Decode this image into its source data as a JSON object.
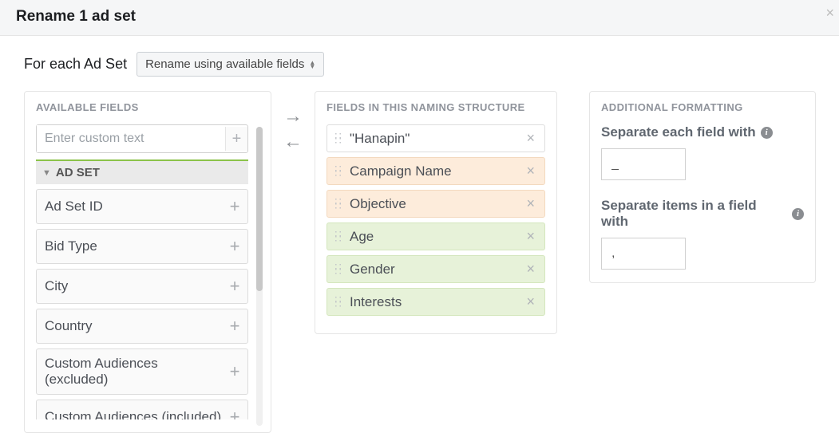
{
  "header": {
    "title": "Rename 1 ad set"
  },
  "toprow": {
    "label": "For each Ad Set",
    "mode": "Rename using available fields"
  },
  "available": {
    "title": "AVAILABLE FIELDS",
    "custom_placeholder": "Enter custom text",
    "group_label": "AD SET",
    "fields": [
      "Ad Set ID",
      "Bid Type",
      "City",
      "Country",
      "Custom Audiences (excluded)",
      "Custom Audiences (included)"
    ]
  },
  "structure": {
    "title": "FIELDS IN THIS NAMING STRUCTURE",
    "items": [
      {
        "label": "\"Hanapin\"",
        "tone": "white"
      },
      {
        "label": "Campaign Name",
        "tone": "orange"
      },
      {
        "label": "Objective",
        "tone": "orange"
      },
      {
        "label": "Age",
        "tone": "green"
      },
      {
        "label": "Gender",
        "tone": "green"
      },
      {
        "label": "Interests",
        "tone": "green"
      }
    ]
  },
  "formatting": {
    "title": "ADDITIONAL FORMATTING",
    "sep_field_label": "Separate each field with",
    "sep_field_value": "_",
    "sep_items_label": "Separate items in a field with",
    "sep_items_value": ","
  }
}
